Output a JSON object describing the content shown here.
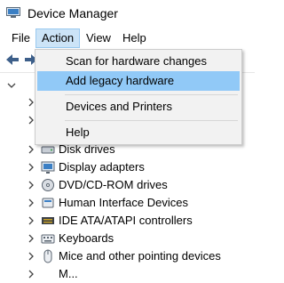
{
  "window": {
    "title": "Device Manager"
  },
  "menubar": {
    "file": "File",
    "action": "Action",
    "view": "View",
    "help": "Help"
  },
  "action_menu": {
    "items": [
      {
        "label": "Scan for hardware changes"
      },
      {
        "label": "Add legacy hardware"
      },
      {
        "label": "Devices and Printers"
      },
      {
        "label": "Help"
      }
    ]
  },
  "tree": {
    "nodes": [
      {
        "label": "Disk drives"
      },
      {
        "label": "Display adapters"
      },
      {
        "label": "DVD/CD-ROM drives"
      },
      {
        "label": "Human Interface Devices"
      },
      {
        "label": "IDE ATA/ATAPI controllers"
      },
      {
        "label": "Keyboards"
      },
      {
        "label": "Mice and other pointing devices"
      },
      {
        "label": "M..."
      }
    ]
  }
}
